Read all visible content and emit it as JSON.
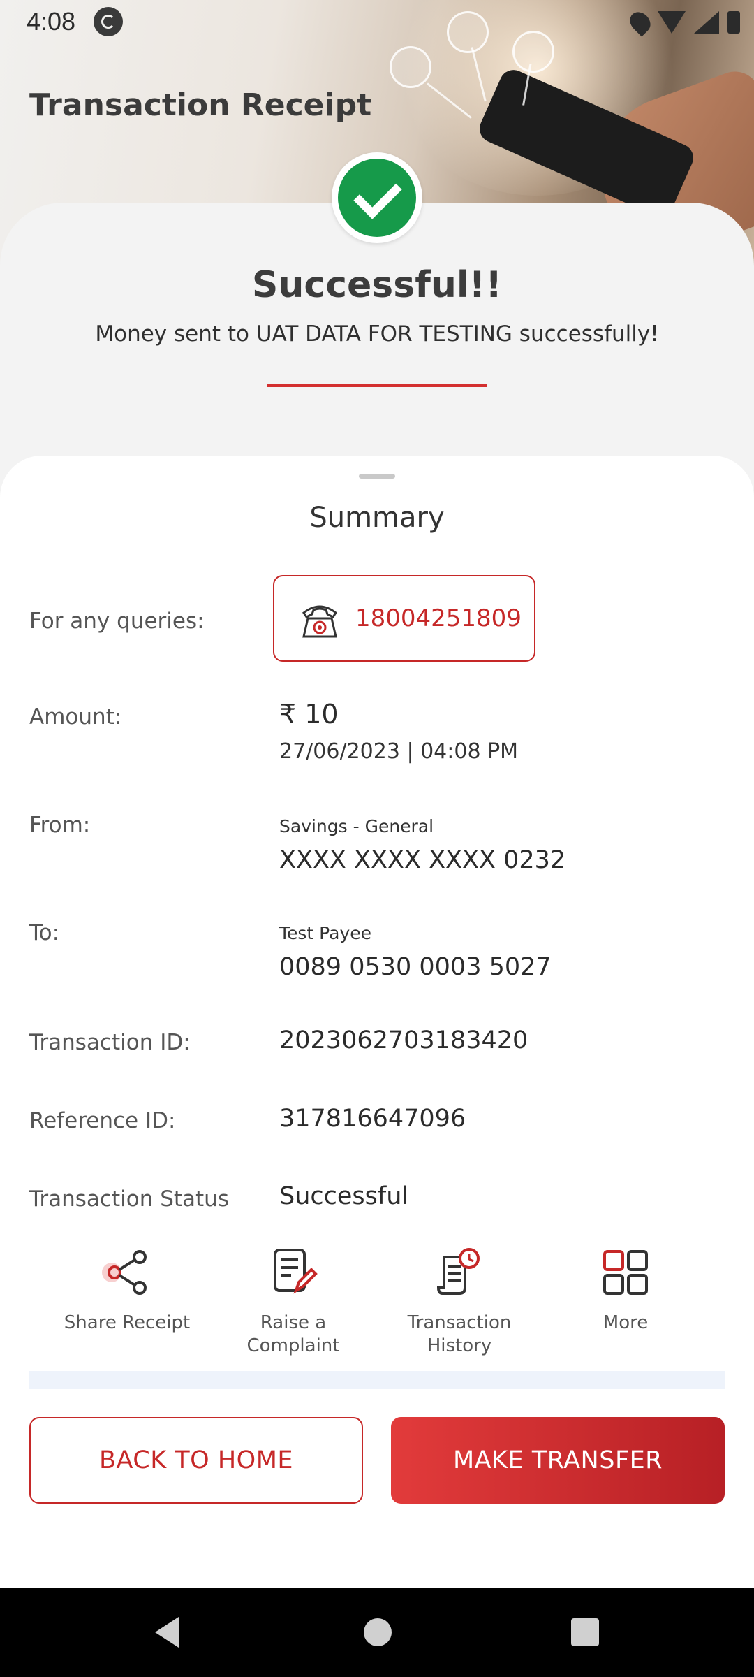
{
  "status_bar": {
    "time": "4:08"
  },
  "header": {
    "title": "Transaction Receipt"
  },
  "result": {
    "title": "Successful!!",
    "message": "Money sent to UAT DATA FOR TESTING successfully!"
  },
  "summary": {
    "title": "Summary",
    "queries": {
      "label": "For any queries:",
      "phone": "18004251809"
    },
    "amount": {
      "label": "Amount:",
      "value": "₹ 10",
      "datetime": "27/06/2023 | 04:08 PM"
    },
    "from": {
      "label": "From:",
      "account_type": "Savings - General",
      "account_number": "XXXX XXXX XXXX 0232"
    },
    "to": {
      "label": "To:",
      "payee_name": "Test Payee",
      "account_number": "0089 0530 0003 5027"
    },
    "transaction_id": {
      "label": "Transaction ID:",
      "value": "2023062703183420"
    },
    "reference_id": {
      "label": "Reference ID:",
      "value": "317816647096"
    },
    "status": {
      "label": "Transaction Status",
      "value": "Successful"
    }
  },
  "actions": [
    {
      "label": "Share Receipt",
      "icon": "share-icon"
    },
    {
      "label": "Raise a\nComplaint",
      "icon": "complaint-icon"
    },
    {
      "label": "Transaction\nHistory",
      "icon": "history-icon"
    },
    {
      "label": "More",
      "icon": "grid-icon"
    }
  ],
  "buttons": {
    "back_home": "BACK TO HOME",
    "make_transfer": "MAKE TRANSFER"
  },
  "colors": {
    "accent": "#c62828",
    "success": "#169a4a"
  }
}
